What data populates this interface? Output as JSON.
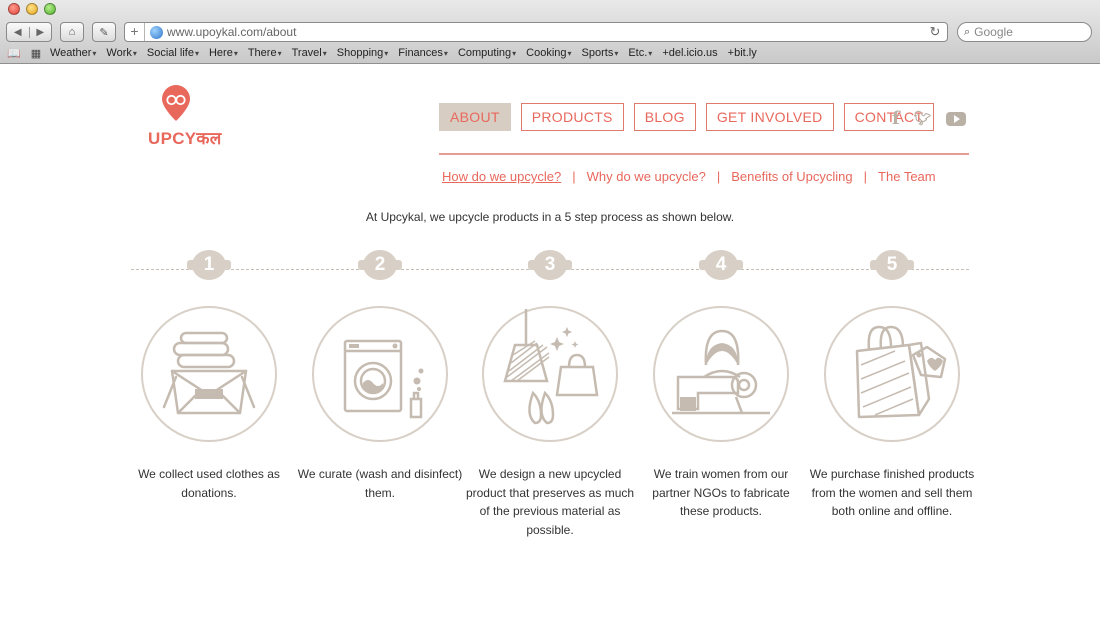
{
  "browser": {
    "url": "www.upoykal.com/about",
    "search_placeholder": "Google",
    "bookmarks": [
      {
        "label": "Weather",
        "menu": true
      },
      {
        "label": "Work",
        "menu": true
      },
      {
        "label": "Social life",
        "menu": true
      },
      {
        "label": "Here",
        "menu": true
      },
      {
        "label": "There",
        "menu": true
      },
      {
        "label": "Travel",
        "menu": true
      },
      {
        "label": "Shopping",
        "menu": true
      },
      {
        "label": "Finances",
        "menu": true
      },
      {
        "label": "Computing",
        "menu": true
      },
      {
        "label": "Cooking",
        "menu": true
      },
      {
        "label": "Sports",
        "menu": true
      },
      {
        "label": "Etc.",
        "menu": true
      },
      {
        "label": "+del.icio.us",
        "menu": false
      },
      {
        "label": "+bit.ly",
        "menu": false
      }
    ]
  },
  "brand": {
    "logo_text": "UPCYकल",
    "accent": "#e8685c",
    "neutral": "#d8cdc2"
  },
  "nav": {
    "items": [
      "ABOUT",
      "PRODUCTS",
      "BLOG",
      "GET INVOLVED",
      "CONTACT"
    ],
    "active": "ABOUT"
  },
  "social": [
    "facebook-icon",
    "twitter-icon",
    "youtube-icon"
  ],
  "subnav": {
    "items": [
      "How do we upcycle?",
      "Why do we upcycle?",
      "Benefits of Upcycling",
      "The Team"
    ],
    "separator": "|",
    "current": "How do we upcycle?"
  },
  "intro": "At Upcykal, we upcycle products in a 5 step process as shown below.",
  "steps": [
    {
      "number": "1",
      "icon": "clothes-basket-icon",
      "text": "We collect used clothes as donations."
    },
    {
      "number": "2",
      "icon": "washing-machine-icon",
      "text": "We curate (wash and disinfect) them."
    },
    {
      "number": "3",
      "icon": "lamp-bag-shoes-icon",
      "text": "We design a new upcycled product that preserves as much of the previous material as possible."
    },
    {
      "number": "4",
      "icon": "woman-sewing-machine-icon",
      "text": "We train women from our partner NGOs to fabricate these products."
    },
    {
      "number": "5",
      "icon": "shopping-bag-icon",
      "text": "We purchase finished products from the women and sell them both online and offline."
    }
  ]
}
